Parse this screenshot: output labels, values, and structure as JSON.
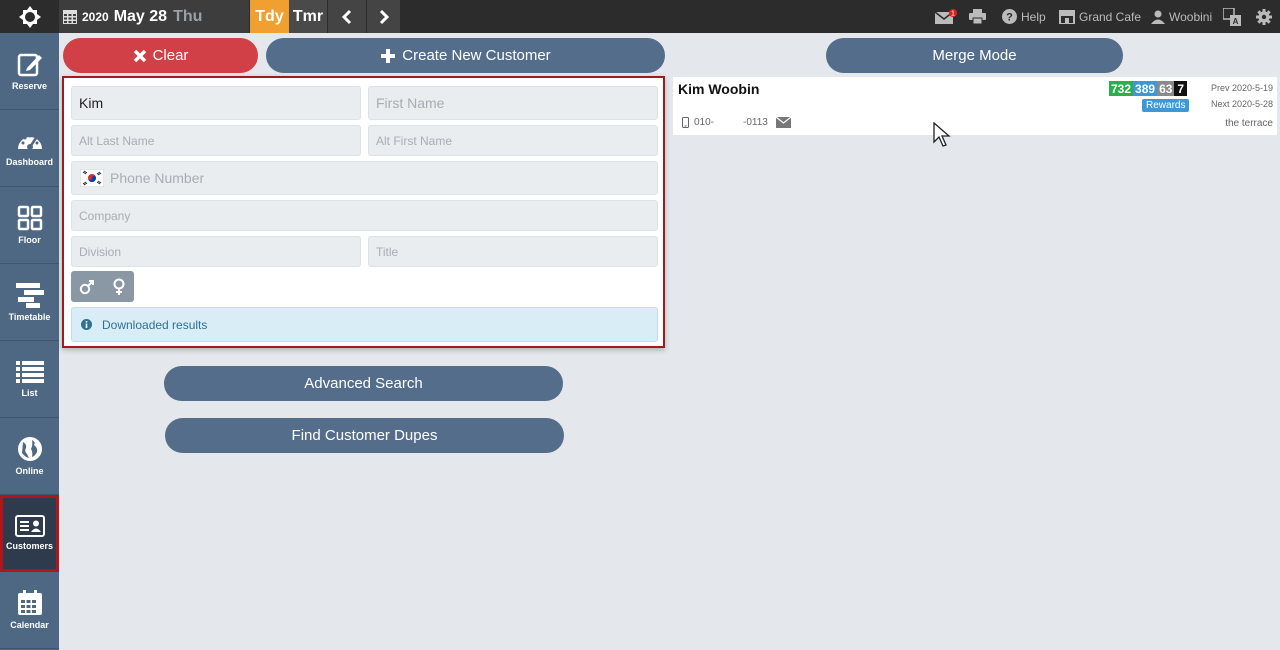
{
  "topbar": {
    "year": "2020",
    "month_day": "May 28",
    "weekday": "Thu",
    "today_label": "Tdy",
    "tomorrow_label": "Tmr",
    "help_label": "Help",
    "restaurant_label": "Grand Cafe",
    "user_label": "Woobini",
    "notification_count": "1"
  },
  "sidebar": {
    "items": [
      {
        "label": "Reserve",
        "icon": "edit-icon"
      },
      {
        "label": "Dashboard",
        "icon": "gauge-icon"
      },
      {
        "label": "Floor",
        "icon": "floor-grid-icon"
      },
      {
        "label": "Timetable",
        "icon": "timetable-icon"
      },
      {
        "label": "List",
        "icon": "list-icon"
      },
      {
        "label": "Online",
        "icon": "globe-icon"
      },
      {
        "label": "Customers",
        "icon": "id-card-icon"
      },
      {
        "label": "Calendar",
        "icon": "calendar-icon"
      }
    ],
    "active": "Customers"
  },
  "actions": {
    "clear_label": "Clear",
    "create_label": "Create New Customer",
    "merge_label": "Merge Mode",
    "advanced_search_label": "Advanced Search",
    "find_dupes_label": "Find Customer Dupes"
  },
  "form": {
    "last_name_value": "Kim",
    "first_name_placeholder": "First Name",
    "alt_last_name_placeholder": "Alt Last Name",
    "alt_first_name_placeholder": "Alt First Name",
    "phone_placeholder": "Phone Number",
    "company_placeholder": "Company",
    "division_placeholder": "Division",
    "title_placeholder": "Title",
    "info_message": "Downloaded results"
  },
  "result": {
    "name": "Kim Woobin",
    "stats": [
      "732",
      "389",
      "63",
      "7"
    ],
    "stat_colors": [
      "#2ab04a",
      "#3c98d6",
      "#8a8a8a",
      "#111111"
    ],
    "rewards_label": "Rewards",
    "prev_visit": "Prev 2020-5-19",
    "next_visit": "Next 2020-5-28",
    "phone_prefix": "010-",
    "phone_suffix": "-0113",
    "location": "the terrace"
  },
  "colors": {
    "topbar": "#2c2c2c",
    "sidebar": "#4e6884",
    "accent_orange": "#f0a030",
    "danger_red": "#d14046",
    "slate_button": "#546d8a"
  }
}
